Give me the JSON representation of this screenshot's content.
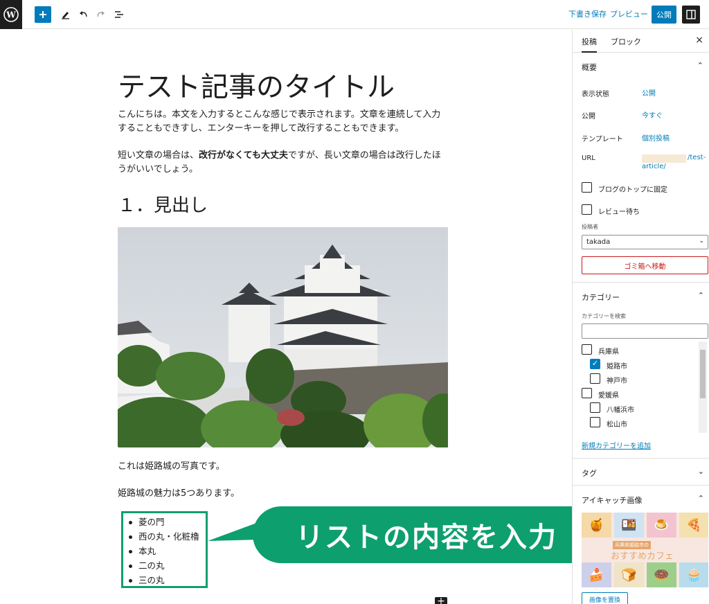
{
  "topbar": {
    "draft_label": "下書き保存",
    "preview_label": "プレビュー",
    "publish_label": "公開"
  },
  "post": {
    "title": "テスト記事のタイトル",
    "para1": "こんにちは。本文を入力するとこんな感じで表示されます。文章を連続して入力することもできすし、エンターキーを押して改行することもできます。",
    "para2_before": "短い文章の場合は、",
    "para2_bold": "改行がなくても大丈夫",
    "para2_after": "ですが、長い文章の場合は改行したほうがいいでしょう。",
    "heading": "１．見出し",
    "caption_para": "これは姫路城の写真です。",
    "intro_para": "姫路城の魅力は5つあります。",
    "list_items": [
      "菱の門",
      "西の丸・化粧櫓",
      "本丸",
      "二の丸",
      "三の丸"
    ]
  },
  "callout": {
    "text": "リストの内容を入力",
    "color": "#0e9f6e"
  },
  "sidebar": {
    "tab_post": "投稿",
    "tab_block": "ブロック",
    "summary": {
      "heading": "概要",
      "visibility_label": "表示状態",
      "visibility_value": "公開",
      "publish_label": "公開",
      "publish_value": "今すぐ",
      "template_label": "テンプレート",
      "template_value": "個別投稿",
      "url_label": "URL",
      "url_value_1": "/test-",
      "url_value_2": "article/",
      "sticky_label": "ブログのトップに固定",
      "pending_label": "レビュー待ち",
      "author_label": "投稿者",
      "author_value": "takada",
      "trash_label": "ゴミ箱へ移動"
    },
    "categories": {
      "heading": "カテゴリー",
      "search_label": "カテゴリーを検索",
      "items": [
        {
          "label": "兵庫県",
          "checked": false,
          "indent": 0
        },
        {
          "label": "姫路市",
          "checked": true,
          "indent": 1
        },
        {
          "label": "神戸市",
          "checked": false,
          "indent": 1
        },
        {
          "label": "愛媛県",
          "checked": false,
          "indent": 0
        },
        {
          "label": "八幡浜市",
          "checked": false,
          "indent": 1
        },
        {
          "label": "松山市",
          "checked": false,
          "indent": 1
        }
      ],
      "add_new": "新規カテゴリーを追加"
    },
    "tags": {
      "heading": "タグ"
    },
    "featured": {
      "heading": "アイキャッチ画像",
      "image_subtitle": "兵庫県姫路市の",
      "image_title": "おすすめカフェ",
      "replace_label": "画像を置換"
    }
  },
  "colors": {
    "accent": "#007cba",
    "danger": "#cc1818",
    "callout": "#0e9f6e"
  }
}
